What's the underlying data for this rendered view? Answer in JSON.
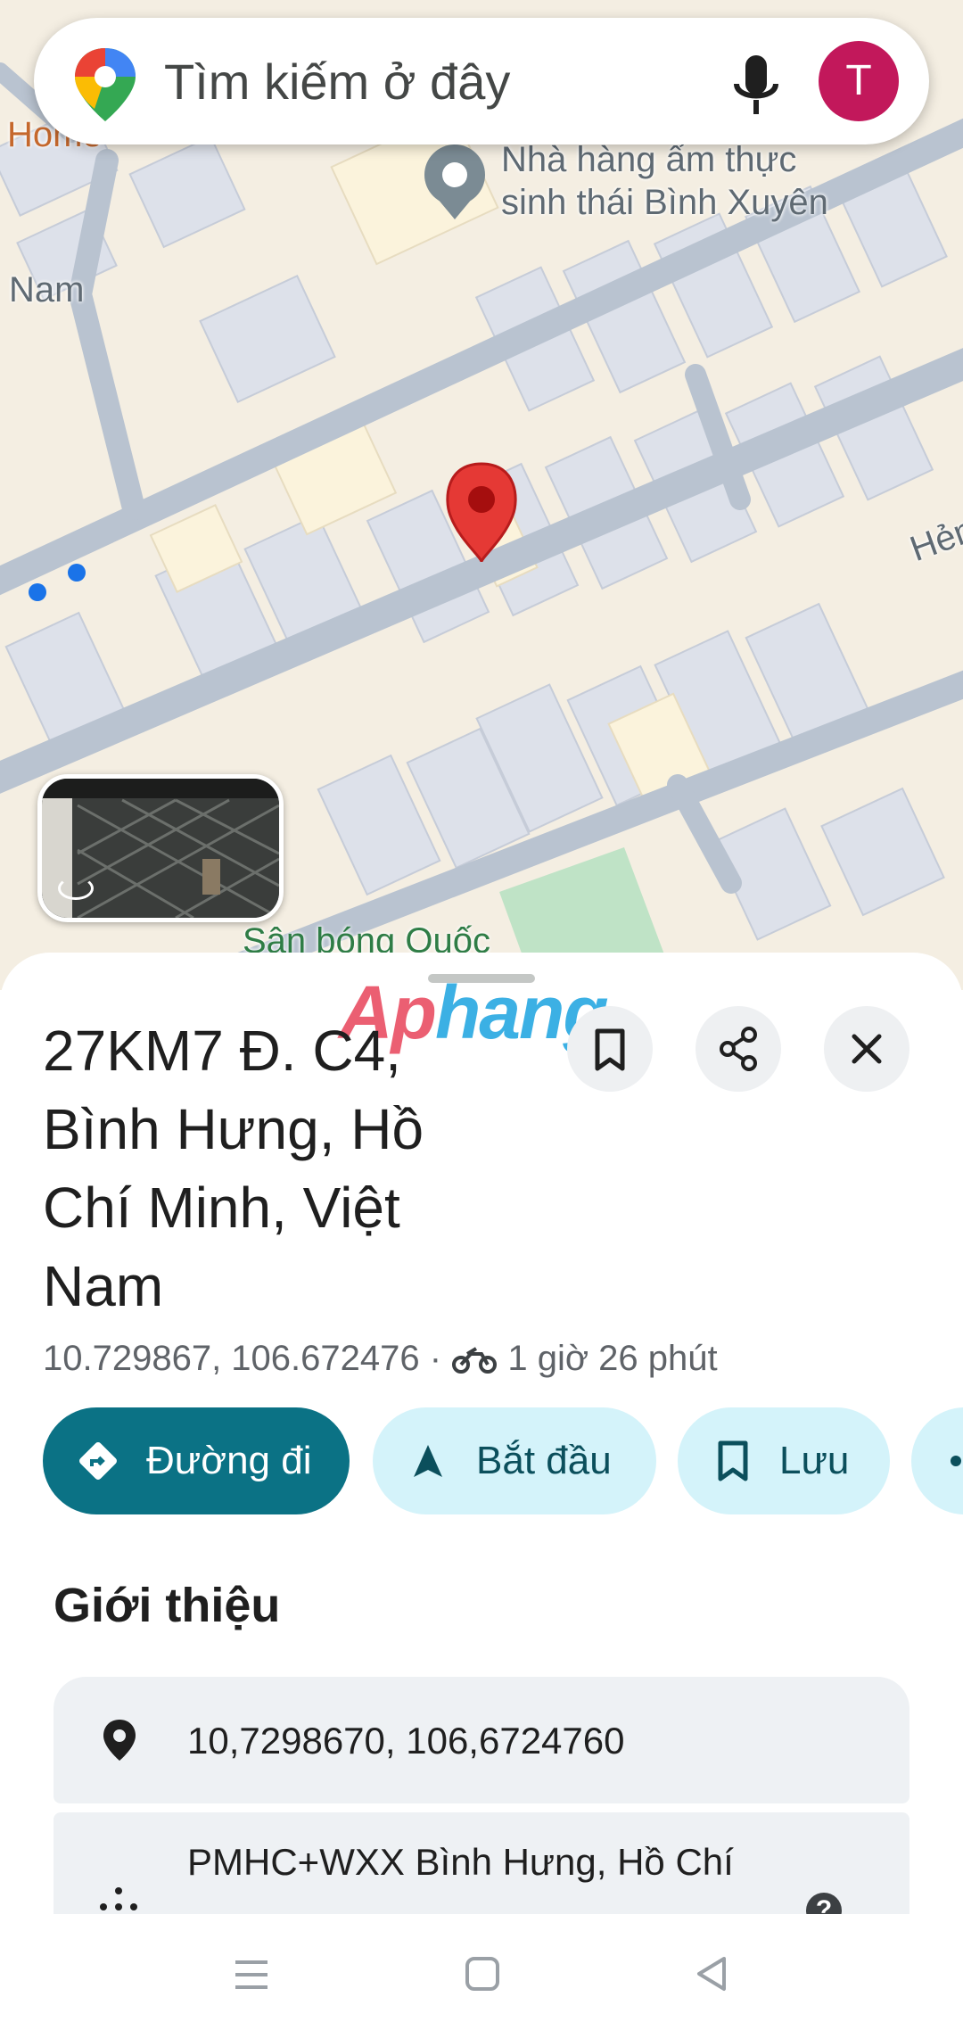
{
  "search": {
    "placeholder": "Tìm kiếm ở đây",
    "avatar_letter": "T",
    "icons": [
      "google-maps-pin-icon",
      "microphone-icon"
    ]
  },
  "map": {
    "labels": {
      "home": "Home",
      "nam": "Nam",
      "restaurant_line1": "Nhà hàng ẩm thực",
      "restaurant_line2": "sinh thái Bình Xuyên",
      "field": "Sân bóng Quốc",
      "alley": "Hẻm"
    },
    "marker_color": "#e53935"
  },
  "watermark": {
    "part1": "Ap",
    "part2": "hang"
  },
  "place": {
    "title": "27KM7 Đ. C4, Bình Hưng, Hồ Chí Minh, Việt Nam",
    "coords": "10.729867, 106.672476",
    "separator": "·",
    "travel_time": "1 giờ 26 phút",
    "travel_icon": "motorbike-icon"
  },
  "actions": {
    "directions": "Đường đi",
    "start": "Bắt đầu",
    "save": "Lưu"
  },
  "about": {
    "title": "Giới thiệu",
    "coordinates": "10,7298670, 106,6724760",
    "plus_code": "PMHC+WXX Bình Hưng, Hồ Chí"
  },
  "colors": {
    "primary": "#0b7285",
    "chip_bg": "#d4f3fa",
    "avatar": "#c2185b"
  }
}
